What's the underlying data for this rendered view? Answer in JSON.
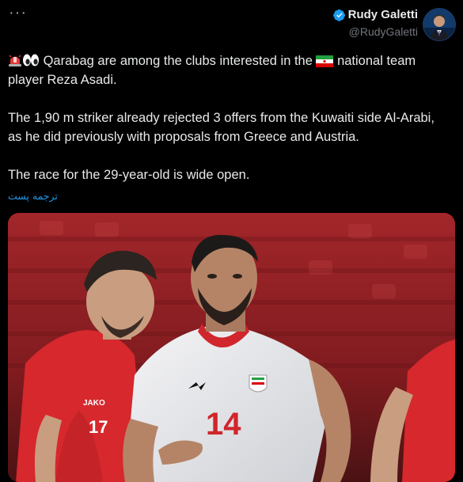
{
  "header": {
    "more_label": "···",
    "display_name": "Rudy Galetti",
    "handle": "@RudyGaletti"
  },
  "tweet": {
    "line1_text": "Qarabag are among the clubs interested in the",
    "line1_text_after_flag": "national team player Reza Asadi.",
    "paragraph2": "The 1,90 m striker already rejected 3 offers from the Kuwaiti side Al-Arabi, as he did previously with proposals from Greece and Austria.",
    "paragraph3": "The race for the 29-year-old is wide open."
  },
  "translate_link": "ترجمه پست",
  "photo": {
    "jersey_number_main": "14",
    "jersey_number_left": "17",
    "sponsor_text": "JAKO"
  },
  "icons": {
    "siren": "police-light-icon",
    "eyes": "eyes-icon",
    "flag": "iran-flag-icon",
    "verified": "verified-badge-icon"
  },
  "colors": {
    "background": "#000000",
    "text": "#e7e9ea",
    "muted": "#71767b",
    "link": "#1d9bf0",
    "verified": "#1d9bf0"
  }
}
